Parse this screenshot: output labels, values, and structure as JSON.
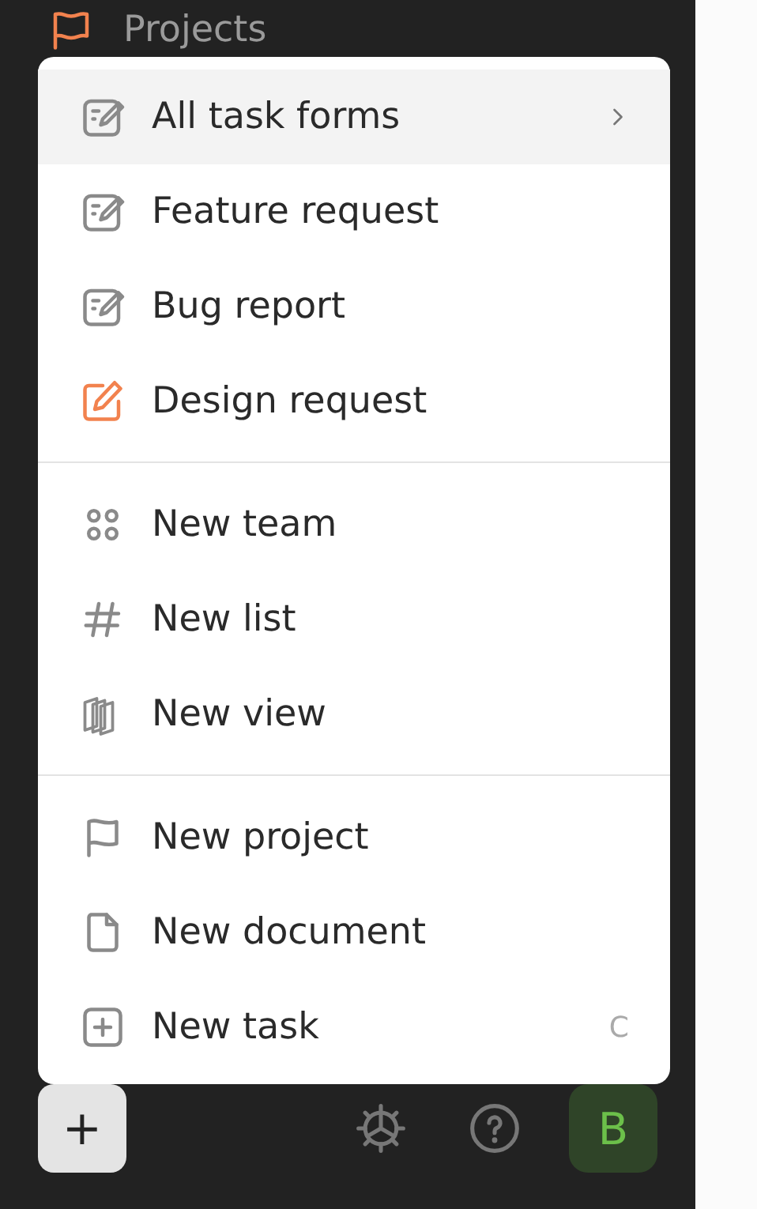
{
  "sidebar": {
    "header": {
      "label": "Projects"
    }
  },
  "menu": {
    "sections": [
      {
        "items": [
          {
            "kind": "form",
            "label": "All task forms",
            "selected": true,
            "has_submenu": true,
            "color": "#8a8a8a"
          },
          {
            "kind": "form",
            "label": "Feature request",
            "selected": false,
            "has_submenu": false,
            "color": "#8a8a8a"
          },
          {
            "kind": "form",
            "label": "Bug report",
            "selected": false,
            "has_submenu": false,
            "color": "#8a8a8a"
          },
          {
            "kind": "edit",
            "label": "Design request",
            "selected": false,
            "has_submenu": false,
            "color": "#f2824e"
          }
        ]
      },
      {
        "items": [
          {
            "kind": "team",
            "label": "New team",
            "selected": false,
            "has_submenu": false,
            "color": "#8a8a8a"
          },
          {
            "kind": "hash",
            "label": "New list",
            "selected": false,
            "has_submenu": false,
            "color": "#8a8a8a"
          },
          {
            "kind": "view",
            "label": "New view",
            "selected": false,
            "has_submenu": false,
            "color": "#8a8a8a"
          }
        ]
      },
      {
        "items": [
          {
            "kind": "flag",
            "label": "New project",
            "selected": false,
            "has_submenu": false,
            "color": "#8a8a8a"
          },
          {
            "kind": "doc",
            "label": "New document",
            "selected": false,
            "has_submenu": false,
            "color": "#8a8a8a"
          },
          {
            "kind": "task",
            "label": "New task",
            "selected": false,
            "has_submenu": false,
            "color": "#8a8a8a",
            "shortcut": "C"
          }
        ]
      }
    ]
  },
  "bottom_bar": {
    "add_button": "+",
    "avatar": "B"
  }
}
